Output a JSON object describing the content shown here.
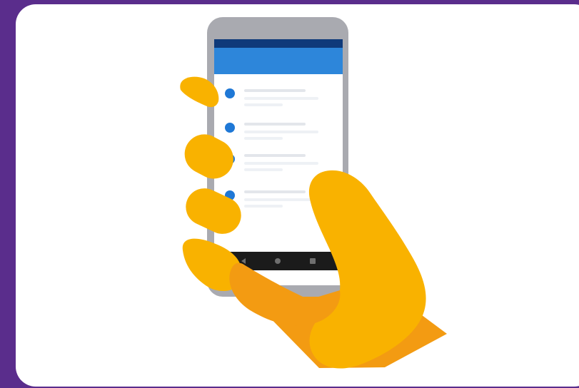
{
  "illustration": {
    "subject": "hand-holding-phone",
    "colors": {
      "background": "#5a2d8c",
      "card": "#ffffff",
      "phone_frame": "#a9aab0",
      "status_bar": "#0f3a7a",
      "app_bar": "#2d86da",
      "screen": "#ffffff",
      "nav_bar": "#1b1b1b",
      "list_dot": "#1f78d6",
      "list_line": "#e3e6eb",
      "skin": "#f9b200",
      "skin_shadow": "#f39b12"
    },
    "phone": {
      "list_items": 4,
      "nav_buttons": [
        "back-icon",
        "home-icon",
        "recents-icon"
      ]
    },
    "icons": [
      "back-icon",
      "home-icon",
      "recents-icon"
    ]
  }
}
